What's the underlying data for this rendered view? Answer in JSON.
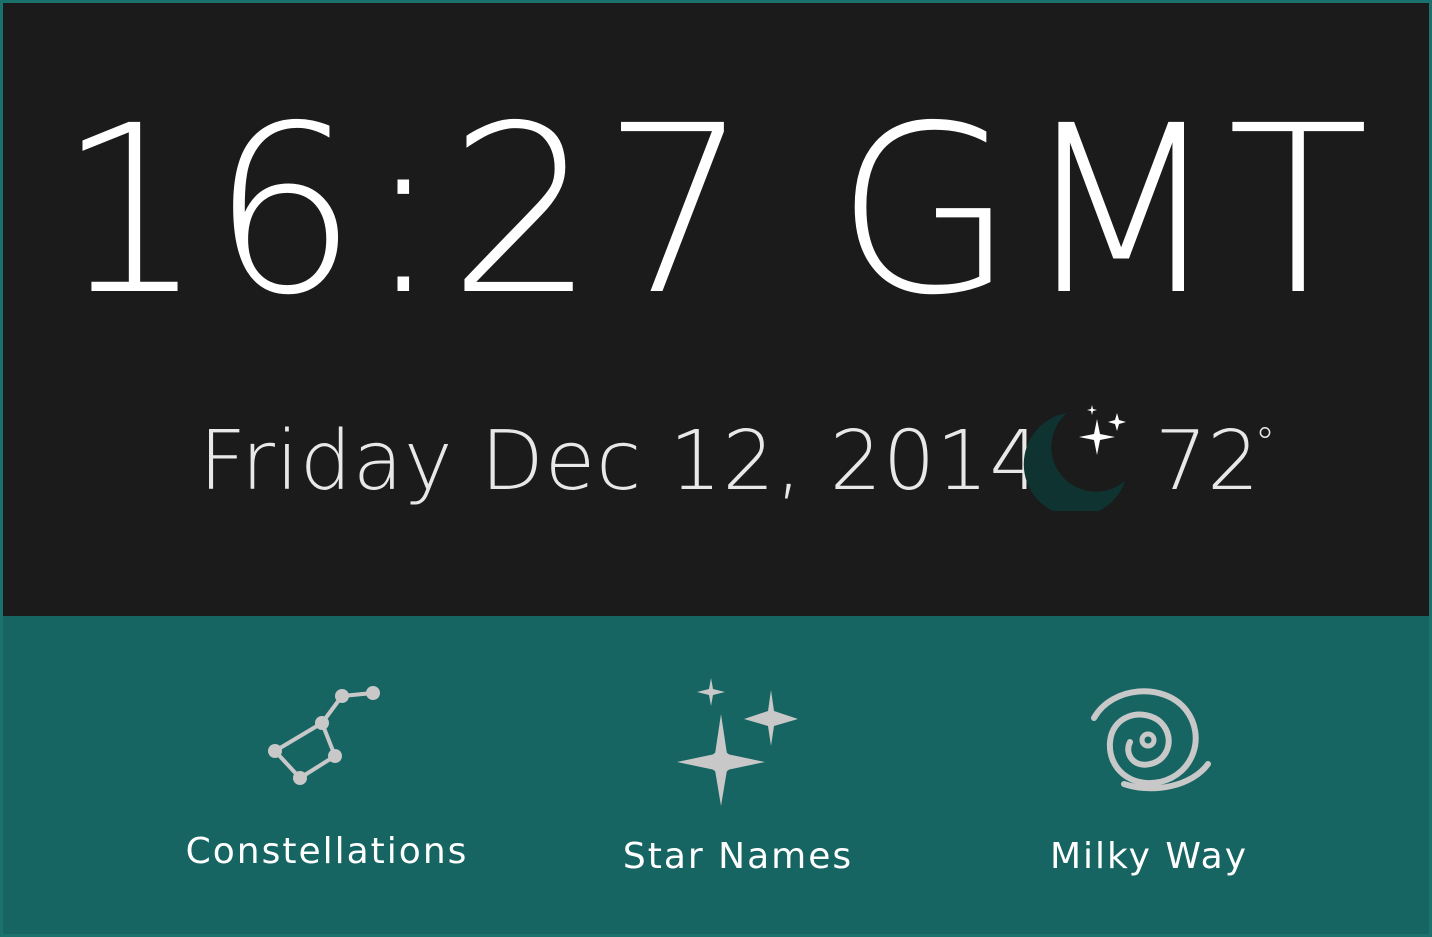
{
  "clock": {
    "time": "16:27 GMT"
  },
  "date": {
    "text": "Friday Dec 12, 2014"
  },
  "weather": {
    "icon": "moon-stars-icon",
    "temperature": "72",
    "degree_symbol": "°"
  },
  "nav": {
    "items": [
      {
        "label": "Constellations",
        "icon": "constellation-icon"
      },
      {
        "label": "Star Names",
        "icon": "stars-icon"
      },
      {
        "label": "Milky Way",
        "icon": "galaxy-spiral-icon"
      }
    ]
  },
  "colors": {
    "top_background": "#1b1b1b",
    "bottom_background": "#176563",
    "border": "#1a716d",
    "icon_gray": "#c8c8c8",
    "moon": "#0e3331",
    "text": "#ffffff"
  }
}
